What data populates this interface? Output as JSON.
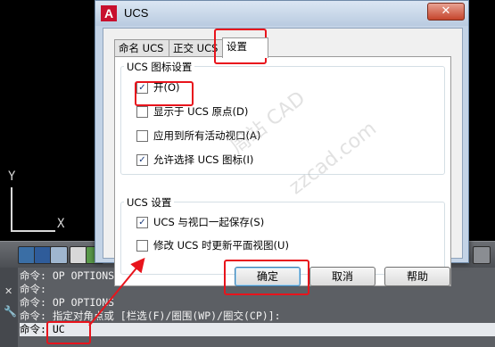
{
  "dialog": {
    "title": "UCS",
    "app_icon_letter": "A",
    "close_glyph": "✕",
    "tabs": [
      {
        "label": "命名 UCS",
        "active": false
      },
      {
        "label": "正交 UCS",
        "active": false
      },
      {
        "label": "设置",
        "active": true
      }
    ],
    "icon_settings": {
      "group_label": "UCS 图标设置",
      "options": [
        {
          "label": "开(O)",
          "checked": true
        },
        {
          "label": "显示于 UCS 原点(D)",
          "checked": false
        },
        {
          "label": "应用到所有活动视口(A)",
          "checked": false
        },
        {
          "label": "允许选择 UCS 图标(I)",
          "checked": true
        }
      ]
    },
    "ucs_settings": {
      "group_label": "UCS 设置",
      "options": [
        {
          "label": "UCS 与视口一起保存(S)",
          "checked": true
        },
        {
          "label": "修改 UCS 时更新平面视图(U)",
          "checked": false
        }
      ]
    },
    "buttons": {
      "ok": "确定",
      "cancel": "取消",
      "help": "帮助"
    }
  },
  "ucs_axes": {
    "x": "X",
    "y": "Y"
  },
  "command_window": {
    "lines": [
      "命令: OP OPTIONS",
      "命令:",
      "命令: OP OPTIONS",
      "命令: 指定对角点或 [栏选(F)/圈围(WP)/圈交(CP)]:"
    ],
    "prompt": "命令: UC"
  },
  "watermark": {
    "text1": "周站 CAD",
    "text2": "zzcad.com"
  },
  "colors": {
    "highlight": "#e8141c",
    "arrow": "#e8141c"
  }
}
